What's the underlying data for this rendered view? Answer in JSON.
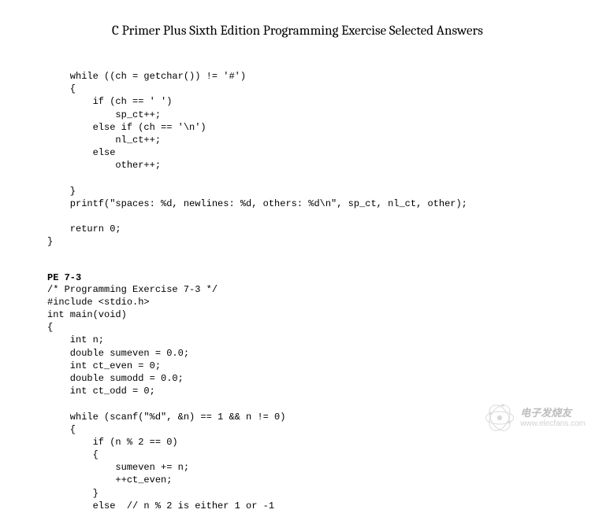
{
  "title": "C Primer Plus Sixth Edition Programming Exercise Selected Answers",
  "code1": "    while ((ch = getchar()) != '#')\n    {\n        if (ch == ' ')\n            sp_ct++;\n        else if (ch == '\\n')\n            nl_ct++;\n        else\n            other++;\n\n    }\n    printf(\"spaces: %d, newlines: %d, others: %d\\n\", sp_ct, nl_ct, other);\n\n    return 0;\n}",
  "section2_label": "PE 7-3",
  "code2": "/* Programming Exercise 7-3 */\n#include <stdio.h>\nint main(void)\n{\n    int n;\n    double sumeven = 0.0;\n    int ct_even = 0;\n    double sumodd = 0.0;\n    int ct_odd = 0;\n\n    while (scanf(\"%d\", &n) == 1 && n != 0)\n    {\n        if (n % 2 == 0)\n        {\n            sumeven += n;\n            ++ct_even;\n        }\n        else  // n % 2 is either 1 or -1",
  "watermark": {
    "cn": "电子发烧友",
    "url": "www.elecfans.com"
  }
}
